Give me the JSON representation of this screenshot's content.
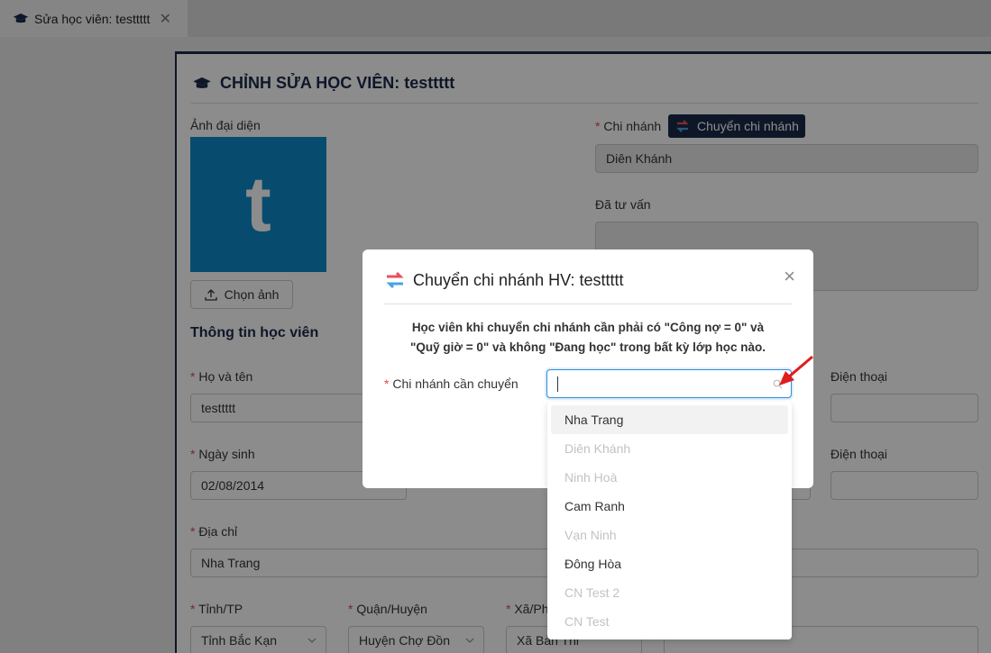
{
  "tab": {
    "label": "Sửa học viên: testtttt",
    "close": "✕"
  },
  "form": {
    "title": "CHỈNH SỬA HỌC VIÊN: testtttt",
    "avatar_label": "Ảnh đại diện",
    "avatar_letter": "t",
    "upload_label": "Chọn ảnh",
    "branch_label": "Chi nhánh",
    "branch_button": "Chuyển chi nhánh",
    "branch_value": "Diên Khánh",
    "consulted_label": "Đã tư vấn",
    "section_title": "Thông tin học viên",
    "fullname_label": "Họ và tên",
    "fullname_value": "testtttt",
    "phone_label": "Điện thoại",
    "dob_label": "Ngày sinh",
    "dob_value": "02/08/2014",
    "phone2_label": "Điện thoại",
    "address_label": "Địa chỉ",
    "address_value": "Nha Trang",
    "province_label": "Tỉnh/TP",
    "province_value": "Tỉnh Bắc Kạn",
    "district_label": "Quận/Huyện",
    "district_value": "Huyện Chợ Đồn",
    "ward_label": "Xã/Ph",
    "ward_value": "Xã Bản Thi"
  },
  "modal": {
    "title": "Chuyển chi nhánh HV: testtttt",
    "close": "×",
    "note_line1": "Học viên khi chuyển chi nhánh cần phải có \"Công nợ = 0\" và",
    "note_line2": "\"Quỹ giờ = 0\" và không \"Đang học\" trong bất kỳ lớp học nào.",
    "target_label": "Chi nhánh cần chuyển"
  },
  "dropdown": {
    "options": [
      {
        "label": "Nha Trang",
        "state": "active"
      },
      {
        "label": "Diên Khánh",
        "state": "disabled"
      },
      {
        "label": "Ninh Hoà",
        "state": "disabled"
      },
      {
        "label": "Cam Ranh",
        "state": "enabled"
      },
      {
        "label": "Vạn Ninh",
        "state": "disabled"
      },
      {
        "label": "Đông Hòa",
        "state": "enabled"
      },
      {
        "label": "CN Test 2",
        "state": "disabled"
      },
      {
        "label": "CN Test",
        "state": "disabled"
      }
    ]
  },
  "colors": {
    "primary": "#1b2a4a",
    "avatar_bg": "#0d8bc9",
    "required": "#e54545",
    "annotation_arrow": "#e11d1d"
  }
}
